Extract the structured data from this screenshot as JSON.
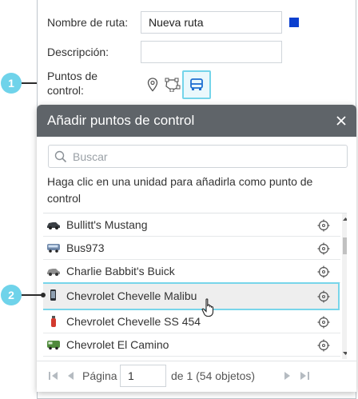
{
  "form": {
    "name_label": "Nombre de ruta:",
    "name_value": "Nueva ruta",
    "route_color": "#0b3fcf",
    "description_label": "Descripción:",
    "description_value": "",
    "checkpoints_label_line1": "Puntos de",
    "checkpoints_label_line2": "control:",
    "checkpoint_tools": [
      "map-marker-icon",
      "geofence-icon",
      "unit-bus-icon"
    ]
  },
  "callouts": {
    "first": "1",
    "second": "2"
  },
  "dialog": {
    "title": "Añadir puntos de control",
    "search_placeholder": "Buscar",
    "hint": "Haga clic en una unidad para añadirla como punto de control",
    "units": [
      {
        "name": "Bullitt's Mustang",
        "icon": "car-icon"
      },
      {
        "name": "Bus973",
        "icon": "bus-icon"
      },
      {
        "name": "Charlie Babbit's Buick",
        "icon": "car-icon"
      },
      {
        "name": "Chevrolet Chevelle Malibu",
        "icon": "phone-icon",
        "highlighted": true
      },
      {
        "name": "Chevrolet Chevelle SS 454",
        "icon": "fire-extinguisher-icon"
      },
      {
        "name": "Chevrolet El Camino",
        "icon": "truck-icon"
      }
    ],
    "pager": {
      "page_label": "Página",
      "page_value": "1",
      "total": "de 1 (54 objetos)"
    }
  },
  "colors": {
    "accent": "#6fd3ea",
    "header": "#5f6469",
    "highlight_border": "#78d5ea"
  }
}
